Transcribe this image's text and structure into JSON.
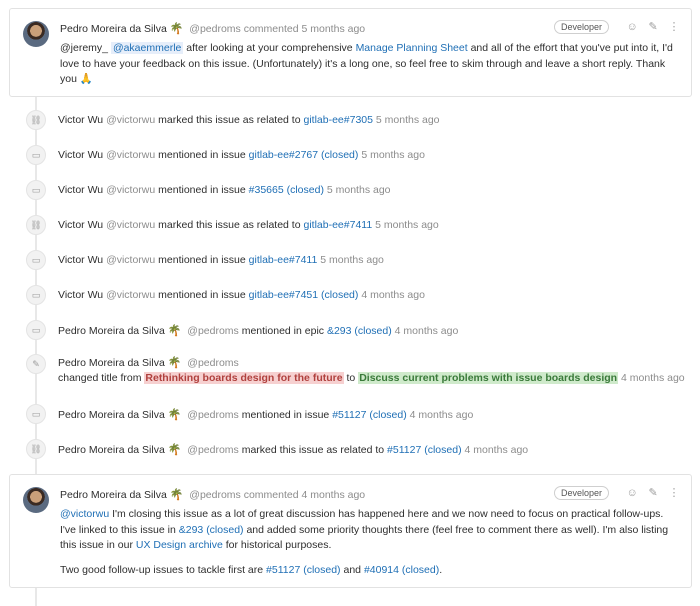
{
  "note1": {
    "author": "Pedro Moreira da Silva",
    "emoji": "🌴",
    "handle": "@pedroms",
    "action": "commented",
    "time": "5 months ago",
    "role": "Developer",
    "mention1": "@jeremy_",
    "mention2": "@akaemmerle",
    "text1": "after looking at your comprehensive",
    "link1": "Manage Planning Sheet",
    "text2": "and all of the effort that you've put into it, I'd love to have your feedback on this issue. (Unfortunately) it's a long one, so feel free to skim through and leave a short reply. Thank you",
    "emoji2": "🙏"
  },
  "events": [
    {
      "icon": "link-icon",
      "author": "Victor Wu",
      "handle": "@victorwu",
      "action": "marked this issue as related to",
      "ref": "gitlab-ee#7305",
      "time": "5 months ago"
    },
    {
      "icon": "comment-icon",
      "author": "Victor Wu",
      "handle": "@victorwu",
      "action": "mentioned in issue",
      "ref": "gitlab-ee#2767 (closed)",
      "time": "5 months ago"
    },
    {
      "icon": "comment-icon",
      "author": "Victor Wu",
      "handle": "@victorwu",
      "action": "mentioned in issue",
      "ref": "#35665 (closed)",
      "time": "5 months ago"
    },
    {
      "icon": "link-icon",
      "author": "Victor Wu",
      "handle": "@victorwu",
      "action": "marked this issue as related to",
      "ref": "gitlab-ee#7411",
      "time": "5 months ago"
    },
    {
      "icon": "comment-icon",
      "author": "Victor Wu",
      "handle": "@victorwu",
      "action": "mentioned in issue",
      "ref": "gitlab-ee#7411",
      "time": "5 months ago"
    },
    {
      "icon": "comment-icon",
      "author": "Victor Wu",
      "handle": "@victorwu",
      "action": "mentioned in issue",
      "ref": "gitlab-ee#7451 (closed)",
      "time": "4 months ago"
    },
    {
      "icon": "comment-icon",
      "author": "Pedro Moreira da Silva",
      "emoji": "🌴",
      "handle": "@pedroms",
      "action": "mentioned in epic",
      "ref": "&293 (closed)",
      "time": "4 months ago"
    }
  ],
  "title_change": {
    "author": "Pedro Moreira da Silva",
    "emoji": "🌴",
    "handle": "@pedroms",
    "prefix": "changed title from",
    "old": "Rethinking boards design for the future",
    "to": "to",
    "new": "Discuss current problems with issue boards design",
    "time": "4 months ago"
  },
  "events2": [
    {
      "icon": "comment-icon",
      "author": "Pedro Moreira da Silva",
      "emoji": "🌴",
      "handle": "@pedroms",
      "action": "mentioned in issue",
      "ref": "#51127 (closed)",
      "time": "4 months ago"
    },
    {
      "icon": "link-icon",
      "author": "Pedro Moreira da Silva",
      "emoji": "🌴",
      "handle": "@pedroms",
      "action": "marked this issue as related to",
      "ref": "#51127 (closed)",
      "time": "4 months ago"
    }
  ],
  "note2": {
    "author": "Pedro Moreira da Silva",
    "emoji": "🌴",
    "handle": "@pedroms",
    "action": "commented",
    "time": "4 months ago",
    "role": "Developer",
    "mention": "@victorwu",
    "t1": "I'm closing this issue as a lot of great discussion has happened here and we now need to focus on practical follow-ups. I've linked to this issue in",
    "ref1": "&293 (closed)",
    "t2": "and added some priority thoughts there (feel free to comment there as well). I'm also listing this issue in our",
    "link": "UX Design archive",
    "t3": "for historical purposes.",
    "p2a": "Two good follow-up issues to tackle first are",
    "ref2": "#51127 (closed)",
    "and": "and",
    "ref3": "#40914 (closed)",
    "end": "."
  }
}
